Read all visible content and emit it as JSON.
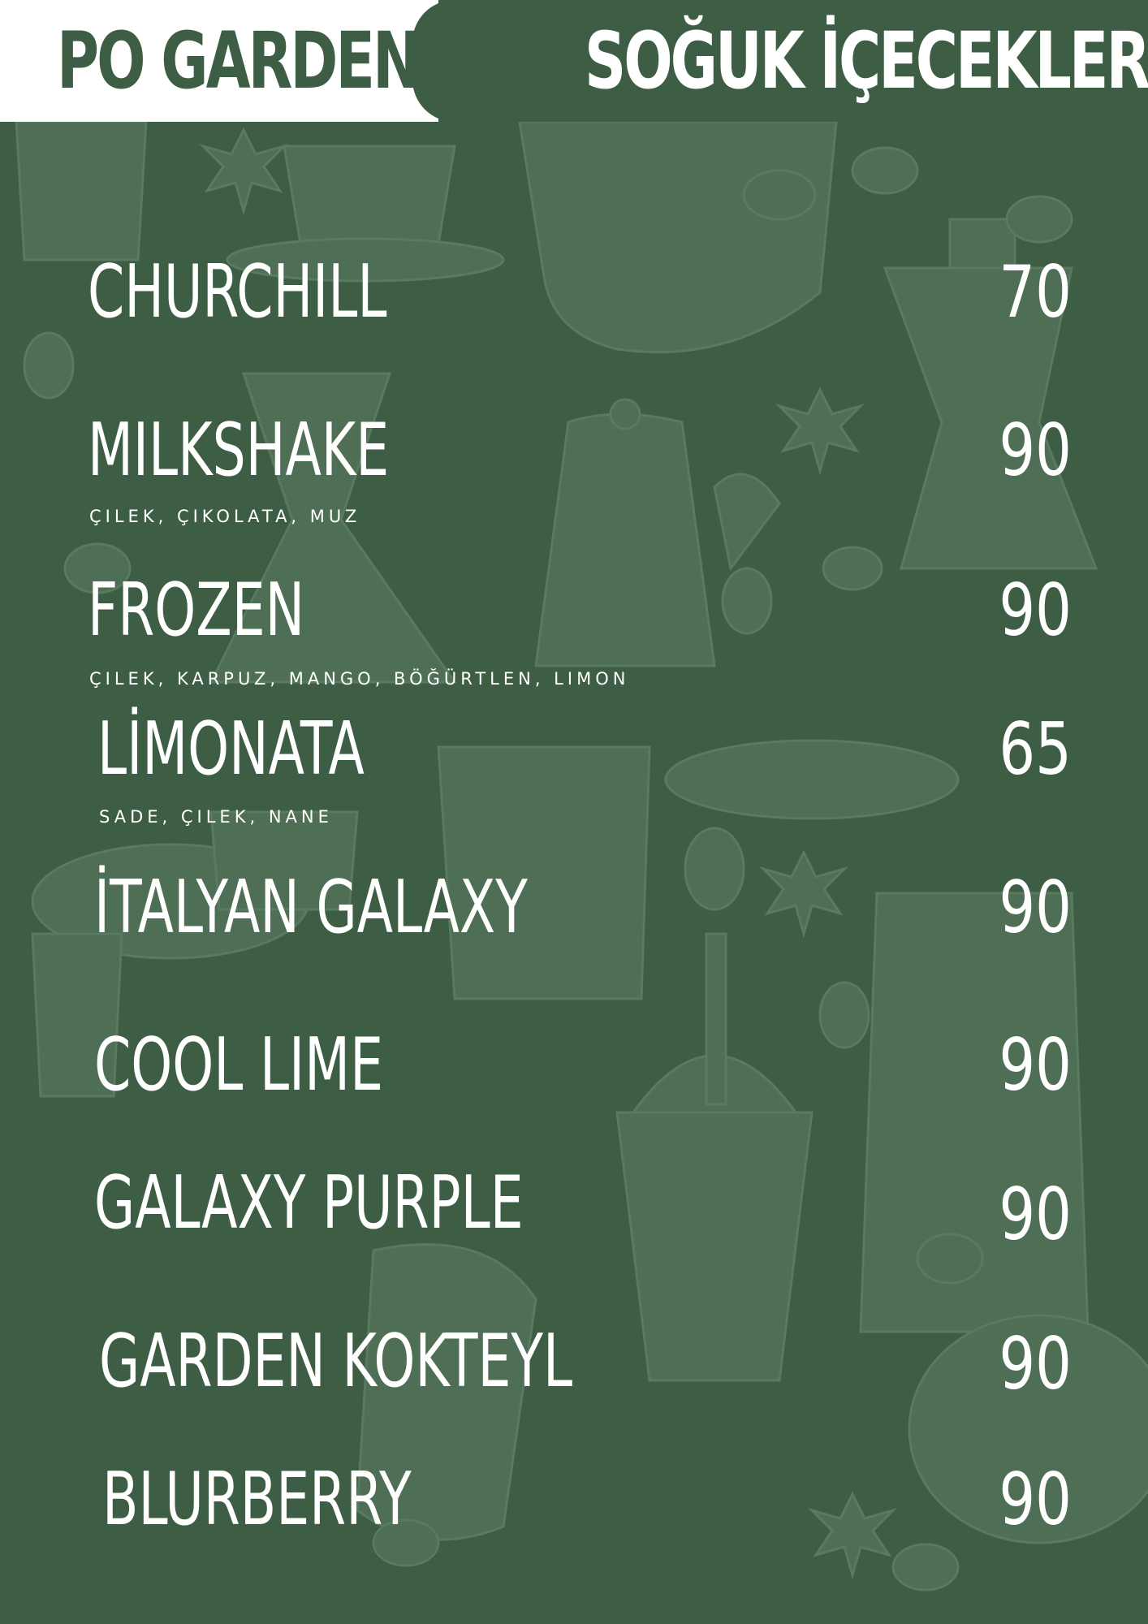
{
  "header": {
    "brand": "PO GARDEN",
    "category": "SOĞUK İÇECEKLER"
  },
  "menu": {
    "items": [
      {
        "name": "CHURCHILL",
        "price": "70",
        "options": ""
      },
      {
        "name": "MILKSHAKE",
        "price": "90",
        "options": "ÇILEK, ÇIKOLATA, MUZ"
      },
      {
        "name": "FROZEN",
        "price": "90",
        "options": "ÇILEK, KARPUZ, MANGO, BÖĞÜRTLEN, LIMON"
      },
      {
        "name": "LİMONATA",
        "price": "65",
        "options": "SADE, ÇILEK, NANE"
      },
      {
        "name": "İTALYAN GALAXY",
        "price": "90",
        "options": ""
      },
      {
        "name": "COOL LIME",
        "price": "90",
        "options": ""
      },
      {
        "name": "GALAXY PURPLE",
        "price": "90",
        "options": ""
      },
      {
        "name": "GARDEN KOKTEYL",
        "price": "90",
        "options": ""
      },
      {
        "name": "BLURBERRY",
        "price": "90",
        "options": ""
      }
    ]
  },
  "colors": {
    "background": "#3d5e44",
    "illustration": "#4e6f55",
    "text": "#ffffff"
  },
  "icons": [
    "coffee-basket-icon",
    "kettle-icon",
    "moka-pot-icon",
    "iced-drink-cup-icon",
    "star-anise-icon",
    "coffee-bean-icon",
    "jar-icon",
    "chemex-icon"
  ]
}
